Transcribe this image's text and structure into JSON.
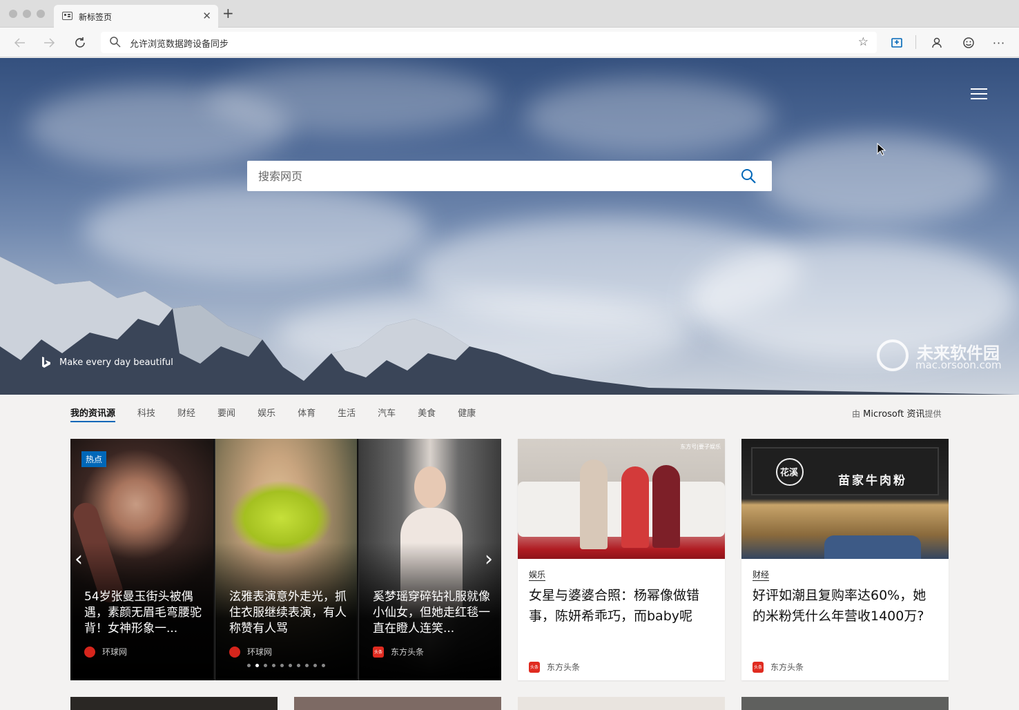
{
  "window": {
    "tab_title": "新标签页"
  },
  "toolbar": {
    "address_text": "允许浏览数据跨设备同步"
  },
  "hero": {
    "search_placeholder": "搜索网页",
    "bing_tagline": "Make every day beautiful",
    "watermark_main": "未来软件园",
    "watermark_sub": "mac.orsoon.com"
  },
  "feed": {
    "nav": [
      "我的资讯源",
      "科技",
      "财经",
      "要闻",
      "娱乐",
      "体育",
      "生活",
      "汽车",
      "美食",
      "健康"
    ],
    "provider_pre": "由",
    "provider_name": "Microsoft 资讯",
    "provider_post": "提供"
  },
  "carousel": {
    "badge": "热点",
    "slides": [
      {
        "title": "54岁张曼玉街头被偶遇，素颜无眉毛弯腰驼背！女神形象一...",
        "source": "环球网"
      },
      {
        "title": "泫雅表演意外走光，抓住衣服继续表演，有人称赞有人骂",
        "source": "环球网"
      },
      {
        "title": "奚梦瑶穿碎钻礼服就像小仙女，但她走红毯一直在瞪人连笑...",
        "source": "东方头条"
      }
    ],
    "dot_count": 10,
    "active_dot": 1
  },
  "cards": [
    {
      "category": "娱乐",
      "title": "女星与婆婆合照：杨幂像做错事，陈妍希乖巧，而baby呢",
      "source": "东方头条",
      "image_caption": "东方号|要子娱乐"
    },
    {
      "category": "财经",
      "title": "好评如潮且复购率达60%，她的米粉凭什么年营收1400万?",
      "source": "东方头条",
      "shop_sign": "苗家牛肉粉",
      "logo_text": "花溪"
    }
  ],
  "colors": {
    "accent": "#0067b8",
    "news_logo": "#e02b20"
  }
}
